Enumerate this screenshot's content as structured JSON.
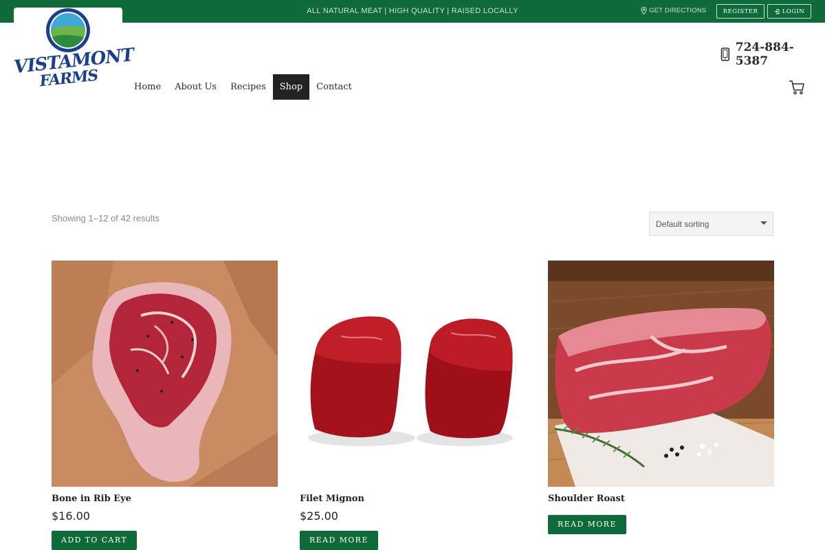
{
  "topbar": {
    "tagline": "ALL NATURAL MEAT | HIGH QUALITY | RAISED LOCALLY",
    "directions_label": "GET DIRECTIONS",
    "register_label": "REGISTER",
    "login_label": "LOGIN"
  },
  "logo": {
    "line1": "VISTAMONT",
    "line2": "FARMS"
  },
  "header": {
    "phone": "724-884-5387"
  },
  "nav": {
    "items": [
      {
        "label": "Home"
      },
      {
        "label": "About Us"
      },
      {
        "label": "Recipes"
      },
      {
        "label": "Shop",
        "active": true
      },
      {
        "label": "Contact"
      }
    ]
  },
  "shop": {
    "results_text": "Showing 1–12 of 42 results",
    "sorting_value": "Default sorting"
  },
  "products": [
    {
      "name": "Bone in Rib Eye",
      "price": "$16.00",
      "button": "ADD TO CART"
    },
    {
      "name": "Filet Mignon",
      "price": "$25.00",
      "button": "READ MORE"
    },
    {
      "name": "Shoulder Roast",
      "button": "READ MORE"
    }
  ],
  "colors": {
    "brand_green": "#0f6a3a",
    "logo_blue": "#1b3f8f",
    "nav_active": "#222222"
  }
}
